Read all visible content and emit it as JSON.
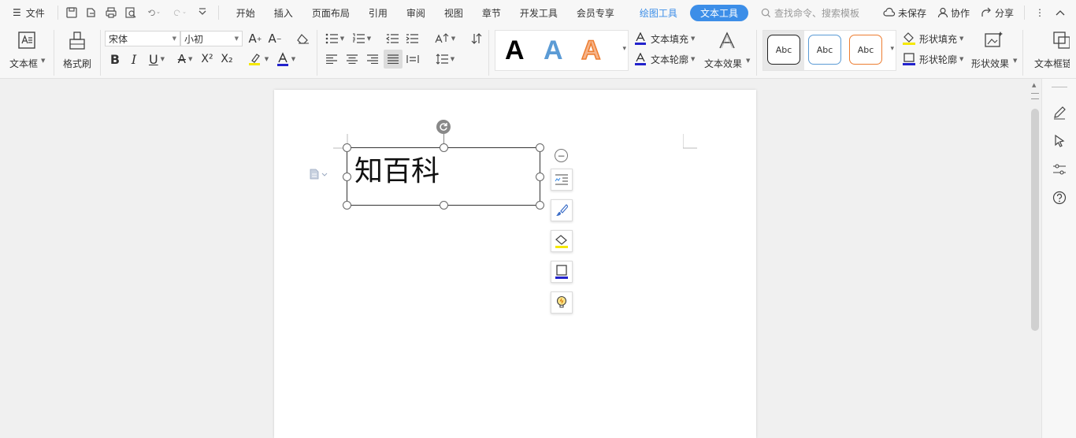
{
  "menubar": {
    "file_label": "文件",
    "tabs": [
      "开始",
      "插入",
      "页面布局",
      "引用",
      "审阅",
      "视图",
      "章节",
      "开发工具",
      "会员专享"
    ],
    "draw_tools": "绘图工具",
    "text_tools": "文本工具",
    "search_placeholder": "查找命令、搜索模板",
    "unsaved": "未保存",
    "collaborate": "协作",
    "share": "分享"
  },
  "ribbon": {
    "textbox_label": "文本框",
    "format_painter": "格式刷",
    "font_name": "宋体",
    "font_size": "小初",
    "text_fill": "文本填充",
    "text_outline": "文本轮廓",
    "text_effect": "文本效果",
    "shape_fill": "形状填充",
    "shape_outline": "形状轮廓",
    "shape_effect": "形状效果",
    "textbox_link": "文本框链",
    "style_glyph": "A",
    "shape_style_label": "Abc",
    "bold": "B",
    "italic": "I",
    "underline": "U",
    "strike": "A",
    "superscript": "X²",
    "subscript": "X₂",
    "colors": {
      "accent": "#3c8ee8",
      "style_blue": "#5b9bd5",
      "style_orange": "#ed7d31",
      "highlight": "#f5e800",
      "font_color": "#2222cc"
    }
  },
  "document": {
    "textbox_text": "知百科"
  }
}
